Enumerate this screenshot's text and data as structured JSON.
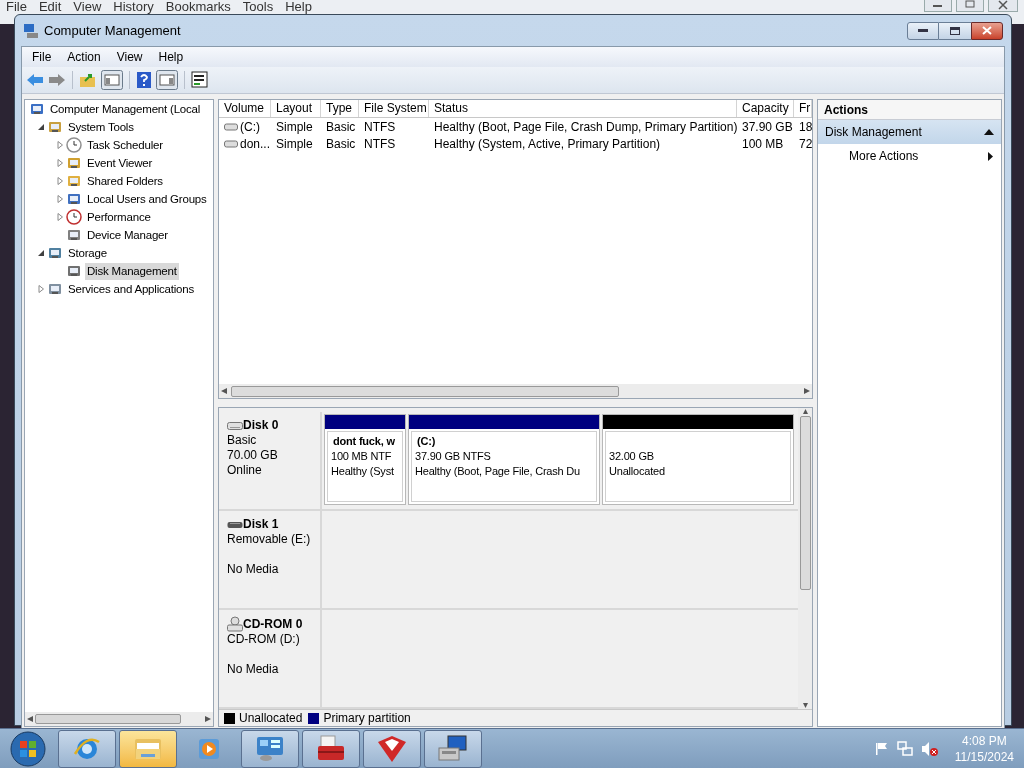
{
  "background_menu": [
    "File",
    "Edit",
    "View",
    "History",
    "Bookmarks",
    "Tools",
    "Help"
  ],
  "window": {
    "title": "Computer Management"
  },
  "menu": [
    "File",
    "Action",
    "View",
    "Help"
  ],
  "tree": [
    {
      "label": "Computer Management (Local",
      "selected": false,
      "children": [
        {
          "label": "System Tools",
          "expanded": true,
          "selected": false,
          "children": [
            {
              "label": "Task Scheduler",
              "expanded": false,
              "selected": false
            },
            {
              "label": "Event Viewer",
              "expanded": false,
              "selected": false
            },
            {
              "label": "Shared Folders",
              "expanded": false,
              "selected": false
            },
            {
              "label": "Local Users and Groups",
              "expanded": false,
              "selected": false
            },
            {
              "label": "Performance",
              "expanded": false,
              "selected": false
            },
            {
              "label": "Device Manager",
              "selected": false
            }
          ]
        },
        {
          "label": "Storage",
          "expanded": true,
          "selected": false,
          "children": [
            {
              "label": "Disk Management",
              "selected": true
            }
          ]
        },
        {
          "label": "Services and Applications",
          "expanded": false,
          "selected": false
        }
      ]
    }
  ],
  "volume_table": {
    "columns": [
      "Volume",
      "Layout",
      "Type",
      "File System",
      "Status",
      "Capacity",
      "Fr"
    ],
    "rows": [
      [
        "(C:)",
        "Simple",
        "Basic",
        "NTFS",
        "Healthy (Boot, Page File, Crash Dump, Primary Partition)",
        "37.90 GB",
        "18"
      ],
      [
        "don...",
        "Simple",
        "Basic",
        "NTFS",
        "Healthy (System, Active, Primary Partition)",
        "100 MB",
        "72"
      ]
    ]
  },
  "disks": [
    {
      "kind": "hdd",
      "name": "Disk 0",
      "type": "Basic",
      "size": "70.00 GB",
      "status": "Online",
      "partitions": [
        {
          "kind": "primary",
          "title": "dont fuck, w",
          "size": "100 MB NTF",
          "status": "Healthy (Syst"
        },
        {
          "kind": "primary",
          "title": "(C:)",
          "size": "37.90 GB NTFS",
          "status": "Healthy (Boot, Page File, Crash Du"
        },
        {
          "kind": "unallocated",
          "size": "32.00 GB",
          "status": "Unallocated"
        }
      ]
    },
    {
      "kind": "removable",
      "name": "Disk 1",
      "type": "Removable (E:)",
      "status": "No Media"
    },
    {
      "kind": "cdrom",
      "name": "CD-ROM 0",
      "type": "CD-ROM (D:)",
      "status": "No Media"
    }
  ],
  "legend": [
    {
      "label": "Unallocated",
      "color": "#000000"
    },
    {
      "label": "Primary partition",
      "color": "#000080"
    }
  ],
  "actions": {
    "title": "Actions",
    "section": {
      "label": "Disk Management",
      "expanded": true,
      "items": [
        {
          "label": "More Actions"
        }
      ]
    }
  },
  "taskbar": {
    "items": [
      {
        "kind": "browser",
        "running": true,
        "selected": false
      },
      {
        "kind": "folder",
        "running": true,
        "selected": true
      },
      {
        "kind": "media",
        "running": false,
        "selected": false
      },
      {
        "kind": "panel",
        "running": true,
        "selected": false
      },
      {
        "kind": "toolbox",
        "running": true,
        "selected": false
      },
      {
        "kind": "cube",
        "running": true,
        "selected": false
      },
      {
        "kind": "computer",
        "running": true,
        "selected": false
      }
    ],
    "time": "4:08 PM",
    "date": "11/15/2024"
  }
}
